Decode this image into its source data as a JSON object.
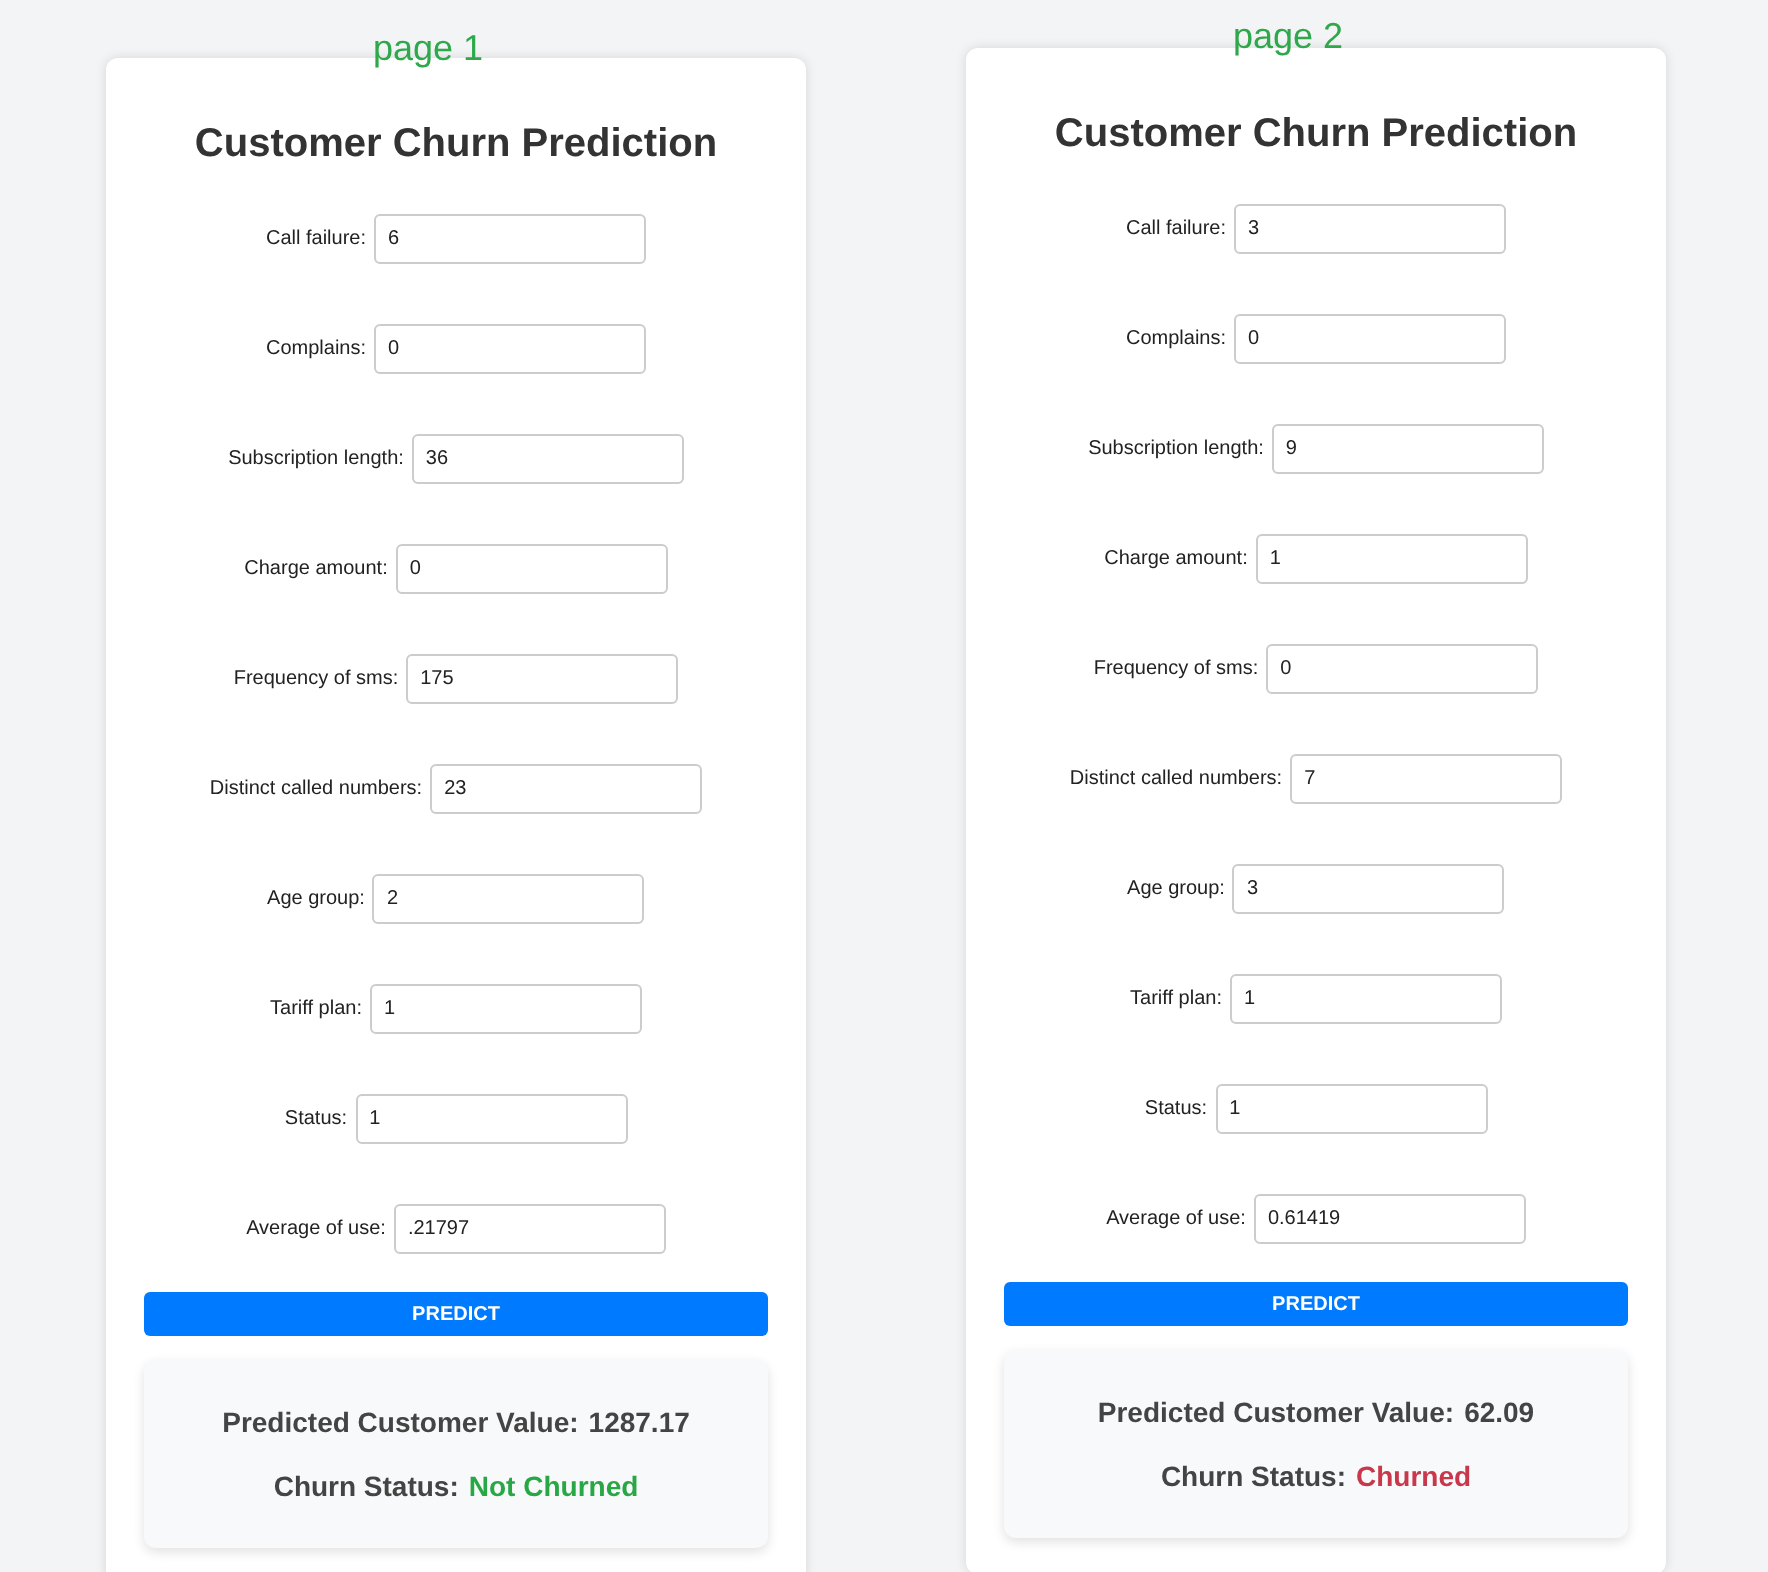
{
  "pages": [
    {
      "label": "page 1",
      "title": "Customer Churn Prediction",
      "fields": [
        {
          "label": "Call failure:",
          "value": "6"
        },
        {
          "label": "Complains:",
          "value": "0"
        },
        {
          "label": "Subscription length:",
          "value": "36"
        },
        {
          "label": "Charge amount:",
          "value": "0"
        },
        {
          "label": "Frequency of sms:",
          "value": "175"
        },
        {
          "label": "Distinct called numbers:",
          "value": "23"
        },
        {
          "label": "Age group:",
          "value": "2"
        },
        {
          "label": "Tariff plan:",
          "value": "1"
        },
        {
          "label": "Status:",
          "value": "1"
        },
        {
          "label": "Average of use:",
          "value": ".21797"
        }
      ],
      "button": "PREDICT",
      "result": {
        "value_label": "Predicted Customer Value:",
        "value": "1287.17",
        "status_label": "Churn Status:",
        "status": "Not Churned",
        "kind": "not_churned"
      }
    },
    {
      "label": "page 2",
      "title": "Customer Churn Prediction",
      "fields": [
        {
          "label": "Call failure:",
          "value": "3"
        },
        {
          "label": "Complains:",
          "value": "0"
        },
        {
          "label": "Subscription length:",
          "value": "9"
        },
        {
          "label": "Charge amount:",
          "value": "1"
        },
        {
          "label": "Frequency of sms:",
          "value": "0"
        },
        {
          "label": "Distinct called numbers:",
          "value": "7"
        },
        {
          "label": "Age group:",
          "value": "3"
        },
        {
          "label": "Tariff plan:",
          "value": "1"
        },
        {
          "label": "Status:",
          "value": "1"
        },
        {
          "label": "Average of use:",
          "value": "0.61419"
        }
      ],
      "button": "PREDICT",
      "result": {
        "value_label": "Predicted Customer Value:",
        "value": "62.09",
        "status_label": "Churn Status:",
        "status": "Churned",
        "kind": "churned"
      }
    }
  ]
}
